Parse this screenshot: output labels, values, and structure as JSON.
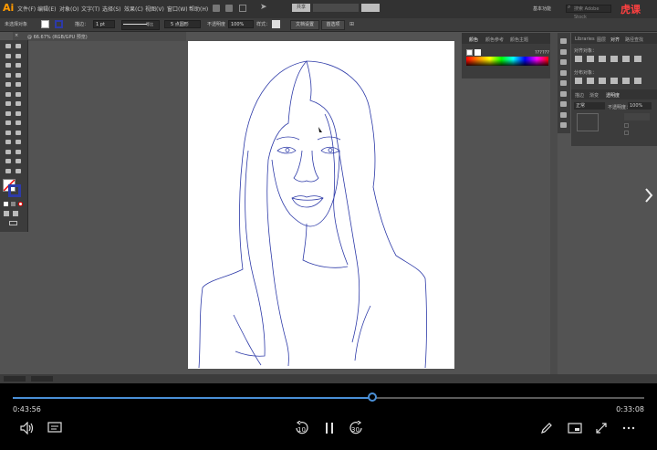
{
  "app": {
    "logo": "Ai",
    "menu": [
      "文件(F)",
      "编辑(E)",
      "对象(O)",
      "文字(T)",
      "选择(S)",
      "效果(C)",
      "视图(V)",
      "窗口(W)",
      "帮助(H)"
    ],
    "share_label": "共享",
    "workspace": "基本功能",
    "search_placeholder": "搜索 Adobe Stock",
    "watermark": "虎课"
  },
  "control_bar": {
    "selection_label": "未选择对象",
    "stroke_label": "描边：",
    "stroke_value": "1 pt",
    "stroke_style": "等比",
    "brush_value": "5 点圆形",
    "opacity_label": "不透明度",
    "opacity_value": "100%",
    "style_label": "样式：",
    "doc_setup_button": "文档设置",
    "preferences_button": "首选项"
  },
  "document": {
    "tab_label": "@ 66.67% (RGB/GPU 预览)"
  },
  "color_panel": {
    "tabs": [
      "颜色",
      "颜色参考",
      "颜色主题"
    ],
    "hex": "??????"
  },
  "align_panel": {
    "tabs": [
      "Libraries",
      "图层",
      "对齐",
      "路径查找"
    ],
    "section_align_objects": "对齐对象：",
    "section_distribute_objects": "分布对象：",
    "section_transparency_tabs": [
      "描边",
      "渐变",
      "透明度"
    ],
    "blend_mode": "正常",
    "opacity_label": "不透明度：",
    "opacity_value": "100%"
  },
  "player": {
    "elapsed": "0:43:56",
    "remaining": "0:33:08",
    "progress": 0.57,
    "skip_back": "10",
    "skip_forward": "30"
  }
}
